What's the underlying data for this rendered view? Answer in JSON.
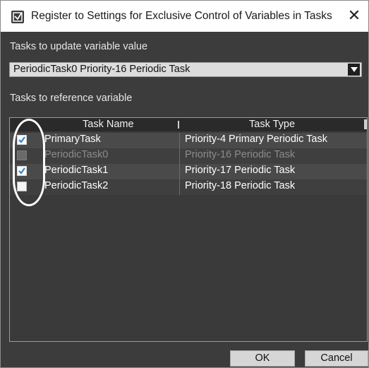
{
  "dialog": {
    "title": "Register to Settings for Exclusive Control of Variables in Tasks",
    "app_icon": "app-window-icon",
    "close_glyph": "✕"
  },
  "update_section": {
    "label": "Tasks to update variable value",
    "selected_task": "PeriodicTask0 Priority-16 Periodic Task"
  },
  "reference_section": {
    "label": "Tasks to reference variable"
  },
  "table": {
    "columns": [
      "Task Name",
      "Task Type"
    ],
    "rows": [
      {
        "task_name": "PrimaryTask",
        "task_type": "Priority-4 Primary Periodic Task",
        "checked": true,
        "enabled": true
      },
      {
        "task_name": "PeriodicTask0",
        "task_type": "Priority-16 Periodic Task",
        "checked": false,
        "enabled": false
      },
      {
        "task_name": "PeriodicTask1",
        "task_type": "Priority-17 Periodic Task",
        "checked": true,
        "enabled": true
      },
      {
        "task_name": "PeriodicTask2",
        "task_type": "Priority-18 Periodic Task",
        "checked": false,
        "enabled": true
      }
    ]
  },
  "buttons": {
    "ok": "OK",
    "cancel": "Cancel"
  },
  "colors": {
    "dialog_background": "#3c3c3c",
    "highlight_oval": "#ffffff"
  }
}
